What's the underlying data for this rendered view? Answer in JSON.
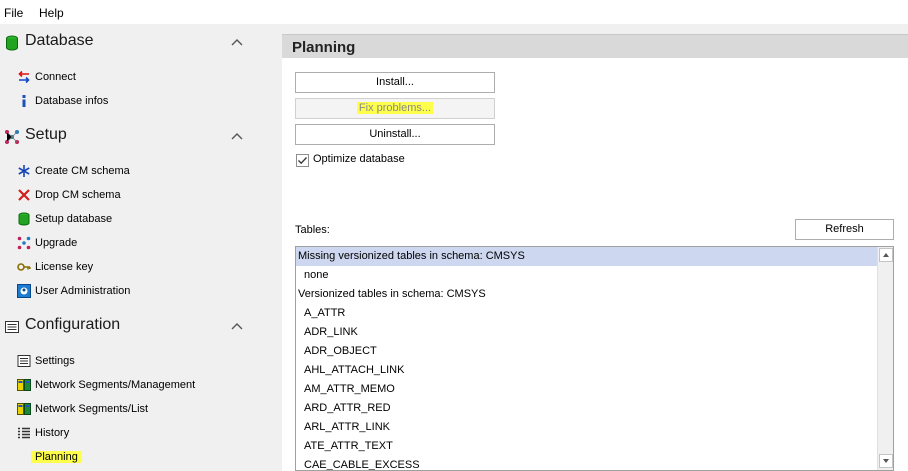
{
  "menu": {
    "file": "File",
    "help": "Help"
  },
  "sidebar": {
    "database": {
      "title": "Database",
      "items": [
        {
          "label": "Connect"
        },
        {
          "label": "Database infos"
        }
      ]
    },
    "setup": {
      "title": "Setup",
      "items": [
        {
          "label": "Create CM schema"
        },
        {
          "label": "Drop CM schema"
        },
        {
          "label": "Setup database"
        },
        {
          "label": "Upgrade"
        },
        {
          "label": "License key"
        },
        {
          "label": "User Administration"
        }
      ]
    },
    "configuration": {
      "title": "Configuration",
      "items": [
        {
          "label": "Settings"
        },
        {
          "label": "Network Segments/Management"
        },
        {
          "label": "Network Segments/List"
        },
        {
          "label": "History"
        },
        {
          "label": "Planning"
        }
      ]
    }
  },
  "panel": {
    "title": "Planning",
    "install_label": "Install...",
    "fix_label": "Fix problems...",
    "uninstall_label": "Uninstall...",
    "optimize_label": "Optimize database",
    "optimize_checked": true,
    "tables_label": "Tables:",
    "refresh_label": "Refresh",
    "tables": [
      {
        "text": "Missing versionized tables in schema: CMSYS",
        "kind": "group",
        "selected": true
      },
      {
        "text": "none",
        "kind": "item"
      },
      {
        "text": "Versionized tables in schema: CMSYS",
        "kind": "group"
      },
      {
        "text": "A_ATTR",
        "kind": "item"
      },
      {
        "text": "ADR_LINK",
        "kind": "item"
      },
      {
        "text": "ADR_OBJECT",
        "kind": "item"
      },
      {
        "text": "AHL_ATTACH_LINK",
        "kind": "item"
      },
      {
        "text": "AM_ATTR_MEMO",
        "kind": "item"
      },
      {
        "text": "ARD_ATTR_RED",
        "kind": "item"
      },
      {
        "text": "ARL_ATTR_LINK",
        "kind": "item"
      },
      {
        "text": "ATE_ATTR_TEXT",
        "kind": "item"
      },
      {
        "text": "CAE_CABLE_EXCESS",
        "kind": "item"
      }
    ]
  },
  "colors": {
    "highlight": "#fdff4a",
    "selection": "#cdd7ef",
    "header": "#d9d9d9"
  }
}
